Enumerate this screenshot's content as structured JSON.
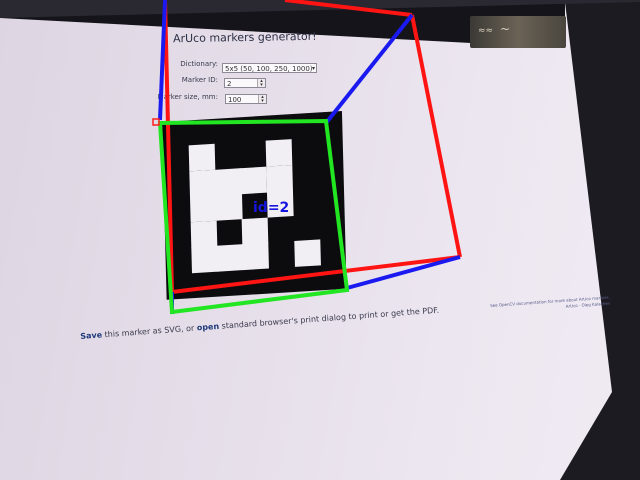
{
  "app": {
    "title": "ArUco markers generator!"
  },
  "form": {
    "dictionary_label": "Dictionary:",
    "dictionary_value": "5x5 (50, 100, 250, 1000)",
    "marker_id_label": "Marker ID:",
    "marker_id_value": "2",
    "marker_size_label": "Marker size, mm:",
    "marker_size_value": "100"
  },
  "footer_text": {
    "save_link": "Save",
    "middle1": " this marker as SVG, or ",
    "open_link": "open",
    "middle2": " standard browser's print dialog to print or get the PDF."
  },
  "credits": {
    "line1": "See OpenCV documentation for more about ArUco markers.",
    "line2": "ArUco · Oleg Kalachev"
  },
  "detection": {
    "label": "id=2",
    "colors": {
      "marker_outline": "#22e622",
      "cube": "#ff1414",
      "axis": "#1a1af0"
    }
  },
  "marker_cells": [
    [
      1,
      0,
      0,
      1,
      0
    ],
    [
      1,
      1,
      1,
      1,
      0
    ],
    [
      1,
      1,
      0,
      1,
      0
    ],
    [
      1,
      0,
      1,
      0,
      0
    ],
    [
      1,
      1,
      1,
      0,
      1
    ]
  ]
}
